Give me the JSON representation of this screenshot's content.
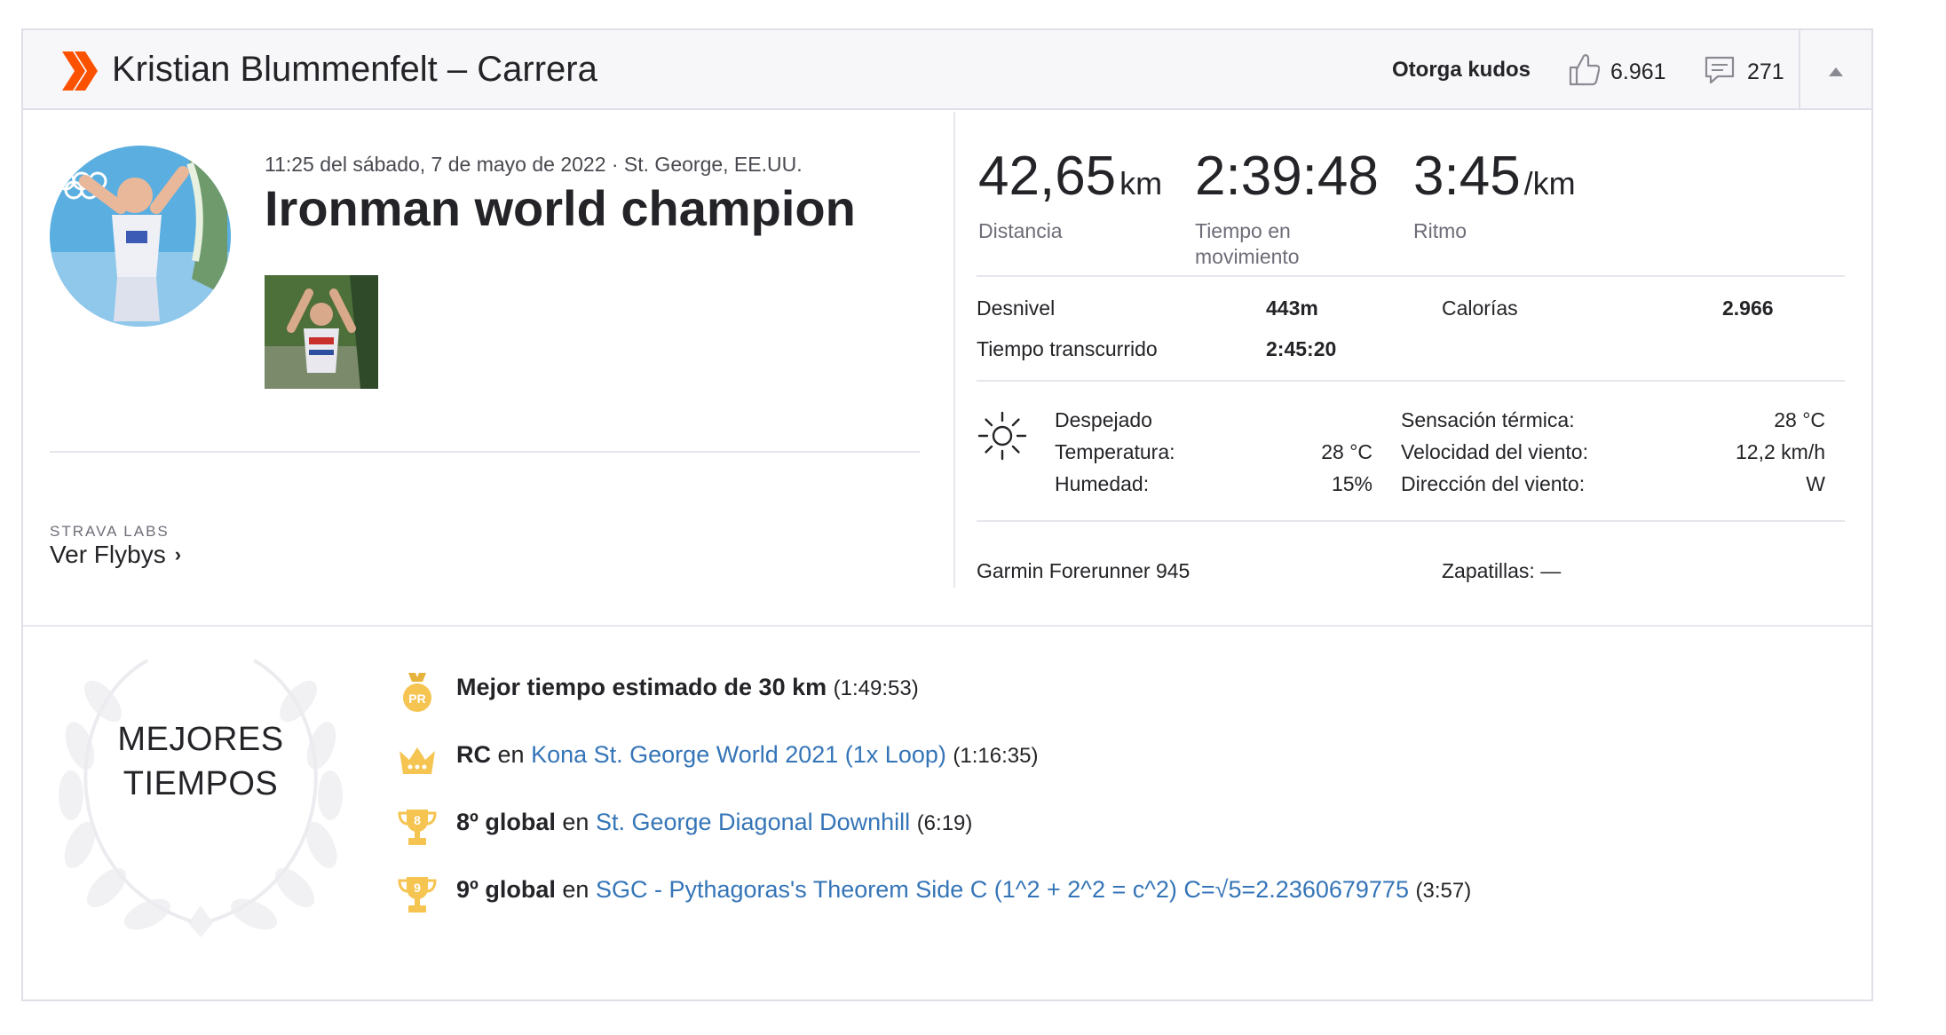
{
  "colors": {
    "brand": "#fc5200",
    "link": "#3575b7",
    "gold": "#f5c451"
  },
  "header": {
    "title": "Kristian Blummenfelt – Carrera",
    "kudos_label": "Otorga kudos",
    "kudos_count": "6.961",
    "comment_count": "271",
    "icons": [
      "strava-logo",
      "thumb-up-icon",
      "comment-icon",
      "chevron-up-icon"
    ]
  },
  "activity": {
    "meta": "11:25 del sábado, 7 de mayo de 2022 · St. George, EE.UU.",
    "name": "Ironman world champion"
  },
  "labs": {
    "label": "STRAVA LABS",
    "link": "Ver Flybys"
  },
  "stats": {
    "distance": {
      "value": "42,65",
      "unit": "km",
      "label": "Distancia"
    },
    "moving_time": {
      "value": "2:39:48",
      "label_line1": "Tiempo en",
      "label_line2": "movimiento"
    },
    "pace": {
      "value": "3:45",
      "unit": "/km",
      "label": "Ritmo"
    }
  },
  "details": {
    "elevation_label": "Desnivel",
    "elevation_value": "443m",
    "calories_label": "Calorías",
    "calories_value": "2.966",
    "elapsed_label": "Tiempo transcurrido",
    "elapsed_value": "2:45:20"
  },
  "weather": {
    "icon": "sun-icon",
    "condition": "Despejado",
    "temperature_label": "Temperatura:",
    "temperature_value": "28 °C",
    "humidity_label": "Humedad:",
    "humidity_value": "15%",
    "feels_like_label": "Sensación térmica:",
    "feels_like_value": "28 °C",
    "wind_speed_label": "Velocidad del viento:",
    "wind_speed_value": "12,2 km/h",
    "wind_dir_label": "Dirección del viento:",
    "wind_dir_value": "W"
  },
  "gear": {
    "device": "Garmin Forerunner 945",
    "shoes": "Zapatillas: —"
  },
  "best_efforts": {
    "title_line1": "MEJORES",
    "title_line2": "TIEMPOS",
    "items": [
      {
        "icon": "pr-medal-icon",
        "bold": "Mejor tiempo estimado de 30 km",
        "connector": "",
        "link": "",
        "time": "(1:49:53)"
      },
      {
        "icon": "crown-icon",
        "bold": "RC",
        "connector": "en",
        "link": "Kona St. George World 2021 (1x Loop)",
        "time": "(1:16:35)"
      },
      {
        "icon": "trophy-8-icon",
        "badge": "8",
        "bold": "8º global",
        "connector": "en",
        "link": "St. George Diagonal Downhill",
        "time": "(6:19)"
      },
      {
        "icon": "trophy-9-icon",
        "badge": "9",
        "bold": "9º global",
        "connector": "en",
        "link": "SGC - Pythagoras's Theorem Side C (1^2 + 2^2 = c^2) C=√5=2.2360679775",
        "time": "(3:57)"
      }
    ]
  }
}
